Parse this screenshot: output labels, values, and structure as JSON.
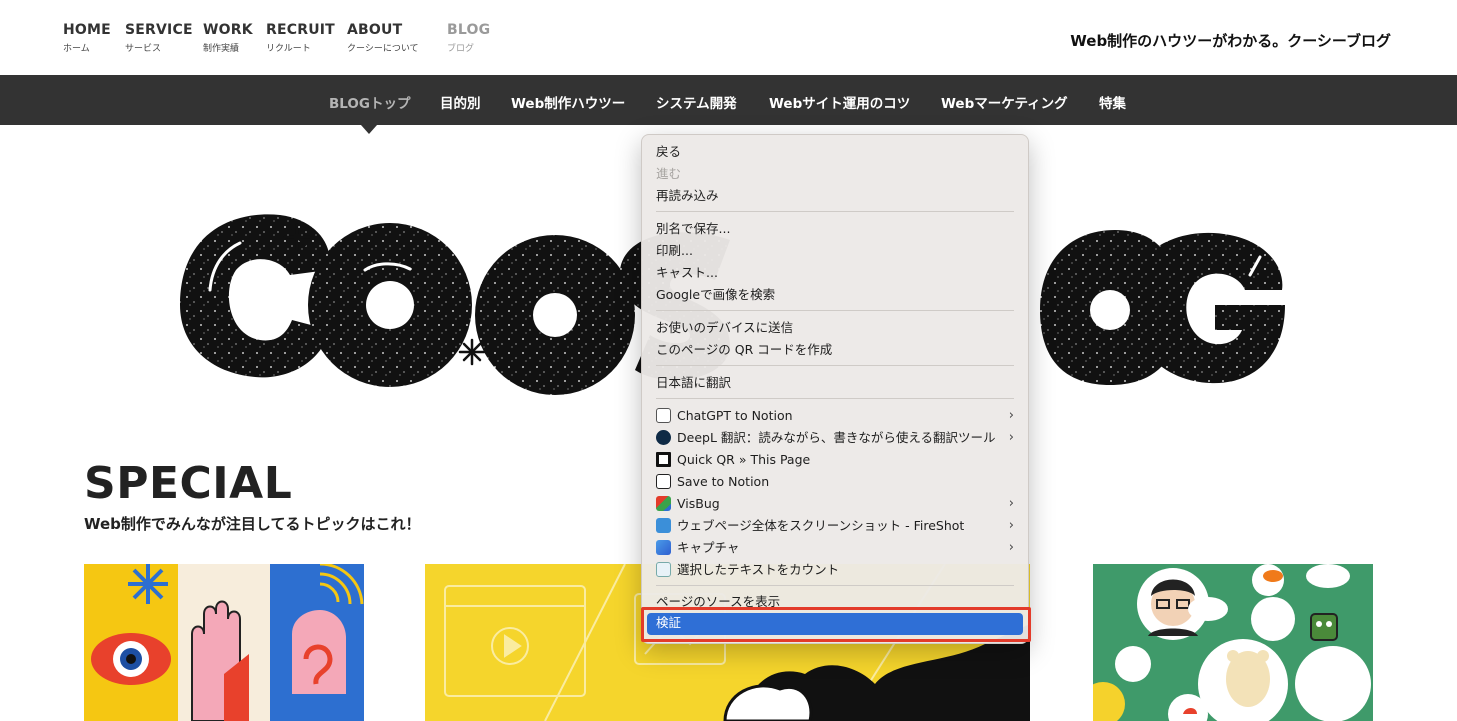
{
  "topnav": {
    "items": [
      {
        "en": "HOME",
        "ja": "ホーム"
      },
      {
        "en": "SERVICE",
        "ja": "サービス"
      },
      {
        "en": "WORK",
        "ja": "制作実績"
      },
      {
        "en": "RECRUIT",
        "ja": "リクルート"
      },
      {
        "en": "ABOUT",
        "ja": "クーシーについて"
      },
      {
        "en": "BLOG",
        "ja": "ブログ"
      }
    ],
    "tagline": "Web制作のハウツーがわかる。クーシーブログ"
  },
  "subnav": {
    "items": [
      "BLOGトップ",
      "目的別",
      "Web制作ハウツー",
      "システム開発",
      "Webサイト運用のコツ",
      "Webマーケティング",
      "特集"
    ]
  },
  "logo": {
    "text": "COOSBLOG"
  },
  "special": {
    "title": "SPECIAL",
    "subtitle": "Web制作でみんなが注目してるトピックはこれ！"
  },
  "context_menu": {
    "items": [
      {
        "label": "戻る"
      },
      {
        "label": "進む"
      },
      {
        "label": "再読み込み"
      },
      {
        "label": "別名で保存..."
      },
      {
        "label": "印刷..."
      },
      {
        "label": "キャスト..."
      },
      {
        "label": "Googleで画像を検索"
      },
      {
        "label": "お使いのデバイスに送信"
      },
      {
        "label": "このページの QR コードを作成"
      },
      {
        "label": "日本語に翻訳"
      },
      {
        "label": "ChatGPT to Notion"
      },
      {
        "label": "DeepL 翻訳：読みながら、書きながら使える翻訳ツール"
      },
      {
        "label": "Quick QR » This Page"
      },
      {
        "label": "Save to Notion"
      },
      {
        "label": "VisBug"
      },
      {
        "label": "ウェブページ全体をスクリーンショット - FireShot"
      },
      {
        "label": "キャプチャ"
      },
      {
        "label": "選択したテキストをカウント"
      },
      {
        "label": "ページのソースを表示"
      },
      {
        "label": "検証"
      }
    ],
    "disabled": [
      "進む"
    ],
    "highlighted": "検証",
    "highlight_color": "#2f6fd6",
    "annotation_color": "#e33b2a"
  },
  "colors": {
    "subnav_bg": "#333333",
    "card2_bg": "#f5d52c",
    "card3_bg": "#3f9a6a"
  }
}
